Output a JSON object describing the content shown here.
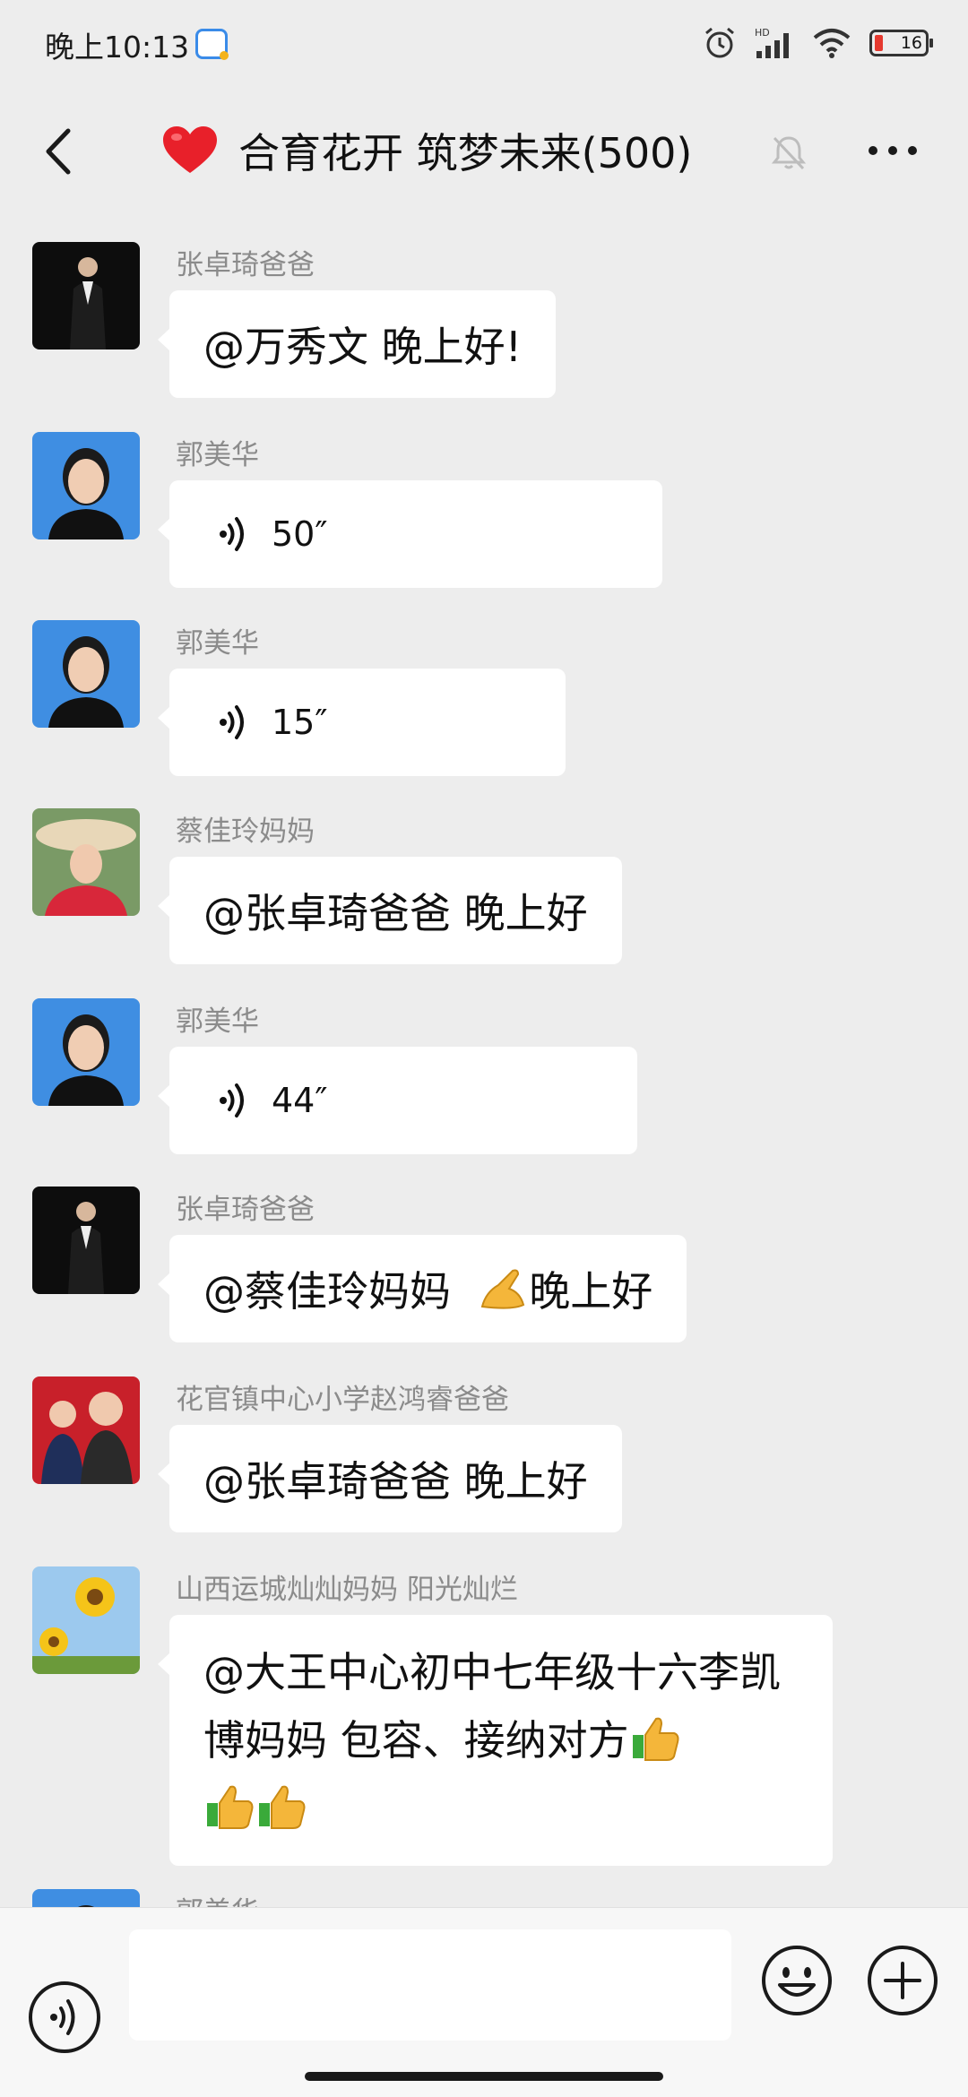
{
  "status_bar": {
    "time": "晚上10:13",
    "battery_level": "16"
  },
  "header": {
    "title": "合育花开 筑梦未来(500)"
  },
  "messages": [
    {
      "sender": "张卓琦爸爸",
      "text": "@万秀文  晚上好!"
    },
    {
      "sender": "郭美华",
      "voice_duration": "50″"
    },
    {
      "sender": "郭美华",
      "voice_duration": "15″"
    },
    {
      "sender": "蔡佳玲妈妈",
      "text": "@张卓琦爸爸  晚上好"
    },
    {
      "sender": "郭美华",
      "voice_duration": "44″"
    },
    {
      "sender": "张卓琦爸爸",
      "text_before_emoji": "@蔡佳玲妈妈  ",
      "text_after_emoji": "晚上好"
    },
    {
      "sender": "花官镇中心小学赵鸿睿爸爸",
      "text": "@张卓琦爸爸  晚上好"
    },
    {
      "sender": "山西运城灿灿妈妈  阳光灿烂",
      "text": "@大王中心初中七年级十六李凯博妈妈  包容、接纳对方"
    },
    {
      "sender": "郭美华"
    }
  ],
  "icons": {
    "back": "chevron-left-icon",
    "group": "heart-icon",
    "mute": "bell-off-icon",
    "more": "more-horizontal-icon",
    "voice": "voice-icon",
    "emoji": "smile-icon",
    "plus": "plus-circle-icon"
  },
  "colors": {
    "background": "#ededed",
    "bubble": "#ffffff",
    "heart": "#e8202a"
  }
}
